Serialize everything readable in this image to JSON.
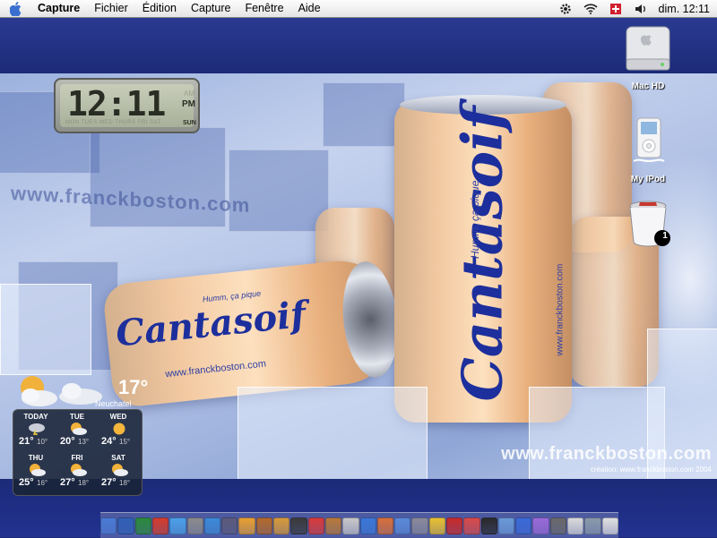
{
  "menubar": {
    "apple_icon": "apple-icon",
    "app_name": "Capture",
    "items": [
      "Fichier",
      "Édition",
      "Capture",
      "Fenêtre",
      "Aide"
    ],
    "status_icons": [
      "gear-icon",
      "wifi-icon",
      "flag-icon",
      "speaker-icon"
    ],
    "clock": "dim. 12:11"
  },
  "clock_widget": {
    "time": "12:11",
    "am_label": "AM",
    "pm_label": "PM",
    "days": [
      "MON",
      "TUES",
      "WED",
      "THURS",
      "FRI",
      "SAT"
    ],
    "active_day": "SUN"
  },
  "weather_widget": {
    "current_temp": "17°",
    "city": "Neuchatel",
    "forecast": [
      {
        "day": "TODAY",
        "hi": "21°",
        "lo": "10°",
        "icon": "storm-icon"
      },
      {
        "day": "TUE",
        "hi": "20°",
        "lo": "13°",
        "icon": "partly-cloudy-icon"
      },
      {
        "day": "WED",
        "hi": "24°",
        "lo": "15°",
        "icon": "sunny-icon"
      },
      {
        "day": "THU",
        "hi": "25°",
        "lo": "16°",
        "icon": "partly-cloudy-icon"
      },
      {
        "day": "FRI",
        "hi": "27°",
        "lo": "18°",
        "icon": "partly-cloudy-icon"
      },
      {
        "day": "SAT",
        "hi": "27°",
        "lo": "18°",
        "icon": "partly-cloudy-icon"
      }
    ]
  },
  "desktop_icons": [
    {
      "label": "Mac HD",
      "icon": "hard-drive-icon"
    },
    {
      "label": "My IPod",
      "icon": "ipod-icon"
    },
    {
      "label": "",
      "icon": "trash-icon",
      "badge": "1"
    }
  ],
  "wallpaper": {
    "brand": "Cantasoif",
    "tagline": "Humm, ça pique",
    "site": "www.franckboston.com",
    "left_watermark": "www.franckboston.com",
    "watermark": "www.franckboston.com",
    "credit": "création: www.franckboston.com  2004"
  },
  "dock": {
    "icons": [
      "finder-icon",
      "word-icon",
      "mail-icon",
      "font-icon",
      "messenger-icon",
      "system-prefs-icon",
      "safari-icon",
      "search-icon",
      "running-man-icon",
      "book-icon",
      "photo-icon",
      "movie-icon",
      "ical-icon",
      "guitar-icon",
      "ipod-icon",
      "itunes-icon",
      "globe-icon",
      "preview-icon",
      "network-icon",
      "sunflower-icon",
      "acrobat-icon",
      "pdf-icon",
      "terminal-icon",
      "address-icon",
      "quicktime-icon",
      "photo-booth-icon",
      "calculator-icon",
      "apple-icon",
      "utility-icon",
      "trash-icon"
    ],
    "colors": [
      "#4a7bd6",
      "#2f5fb5",
      "#2a8a3c",
      "#d43c2c",
      "#4aa0e8",
      "#8c8c8c",
      "#3c8ad8",
      "#5a5a7a",
      "#e8a030",
      "#b46a2a",
      "#d89a3a",
      "#3a3a3a",
      "#d83a3a",
      "#b87a3a",
      "#c8c8c8",
      "#3a78d8",
      "#d8703a",
      "#5a8ad8",
      "#8a8a9a",
      "#e8c030",
      "#c82a2a",
      "#d84a4a",
      "#2a2a2a",
      "#6a9ad8",
      "#3a6ad8",
      "#9a6ad8",
      "#6a6a6a",
      "#dadada",
      "#8a9aaa",
      "#e0e0e0"
    ]
  }
}
